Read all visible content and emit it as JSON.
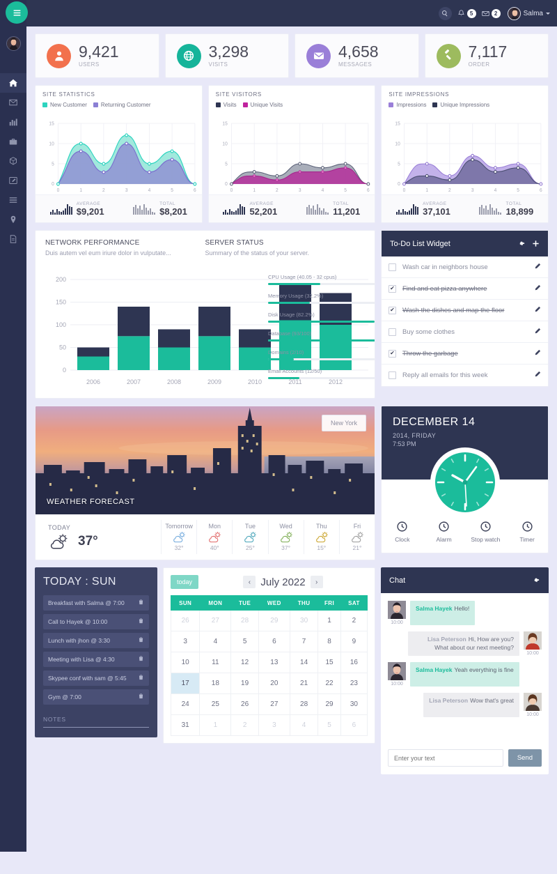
{
  "topbar": {
    "search_icon": "search-icon",
    "notifications_count": "5",
    "messages_count": "2",
    "user_name": "Salma"
  },
  "sidebar": {
    "toggle_icon": "hamburger-icon",
    "items": [
      {
        "icon": "home-icon",
        "active": true
      },
      {
        "icon": "envelope-icon",
        "active": false
      },
      {
        "icon": "bar-chart-icon",
        "active": false
      },
      {
        "icon": "briefcase-icon",
        "active": false
      },
      {
        "icon": "cube-icon",
        "active": false
      },
      {
        "icon": "edit-icon",
        "active": false
      },
      {
        "icon": "list-icon",
        "active": false
      },
      {
        "icon": "map-marker-icon",
        "active": false
      },
      {
        "icon": "file-icon",
        "active": false
      }
    ]
  },
  "stats": [
    {
      "value": "9,421",
      "label": "USERS",
      "color": "#f2714d",
      "icon": "user-icon"
    },
    {
      "value": "3,298",
      "label": "VISITS",
      "color": "#16b49a",
      "icon": "globe-icon"
    },
    {
      "value": "4,658",
      "label": "MESSAGES",
      "color": "#9a7fd8",
      "icon": "envelope-icon"
    },
    {
      "value": "7,117",
      "label": "ORDER",
      "color": "#9dbb5e",
      "icon": "gavel-icon"
    }
  ],
  "chart_data": [
    {
      "type": "area",
      "title": "SITE STATISTICS",
      "x": [
        0,
        1,
        2,
        3,
        4,
        5,
        6
      ],
      "series": [
        {
          "name": "New Customer",
          "color": "#2dd4bf",
          "values": [
            0,
            10,
            5,
            12,
            5,
            8,
            0
          ]
        },
        {
          "name": "Returning Customer",
          "color": "#8b7fd4",
          "values": [
            0,
            8,
            3,
            10,
            3,
            6,
            0
          ]
        }
      ],
      "ylim": [
        0,
        15
      ],
      "yticks": [
        0,
        5,
        10,
        15
      ],
      "xlabel": "",
      "ylabel": "",
      "grid": true,
      "legend": "top",
      "footer": {
        "average_label": "AVERAGE",
        "average_value": "$9,201",
        "total_label": "TOTAL",
        "total_value": "$8,201"
      }
    },
    {
      "type": "area",
      "title": "SITE VISITORS",
      "x": [
        0,
        1,
        2,
        3,
        4,
        5,
        6
      ],
      "series": [
        {
          "name": "Visits",
          "color": "#2e3552",
          "values": [
            0,
            3,
            2,
            5,
            4,
            5,
            0
          ]
        },
        {
          "name": "Unique Visits",
          "color": "#c0239e",
          "values": [
            0,
            2,
            1,
            3,
            3,
            4,
            0
          ]
        }
      ],
      "ylim": [
        0,
        15
      ],
      "yticks": [
        0,
        5,
        10,
        15
      ],
      "xlabel": "",
      "ylabel": "",
      "grid": true,
      "legend": "top",
      "footer": {
        "average_label": "AVERAGE",
        "average_value": "52,201",
        "total_label": "TOTAL",
        "total_value": "11,201"
      }
    },
    {
      "type": "area",
      "title": "SITE IMPRESSIONS",
      "x": [
        0,
        1,
        2,
        3,
        4,
        5,
        6
      ],
      "series": [
        {
          "name": "Impressions",
          "color": "#9a7fd8",
          "values": [
            0,
            5,
            2,
            7,
            4,
            5,
            0
          ]
        },
        {
          "name": "Unique Impressions",
          "color": "#2e3552",
          "values": [
            0,
            2,
            1,
            6,
            3,
            4,
            0
          ]
        }
      ],
      "ylim": [
        0,
        15
      ],
      "yticks": [
        0,
        5,
        10,
        15
      ],
      "xlabel": "",
      "ylabel": "",
      "grid": true,
      "legend": "top",
      "footer": {
        "average_label": "AVERAGE",
        "average_value": "37,101",
        "total_label": "TOTAL",
        "total_value": "18,899"
      }
    },
    {
      "type": "bar",
      "title": "NETWORK PERFORMANCE",
      "subtitle": "Duis autem vel eum iriure dolor in vulputate...",
      "categories": [
        "2006",
        "2007",
        "2008",
        "2009",
        "2010",
        "2011",
        "2012"
      ],
      "series": [
        {
          "name": "lower",
          "color": "#1bbc9b",
          "values": [
            30,
            75,
            50,
            75,
            50,
            110,
            100
          ]
        },
        {
          "name": "upper",
          "color": "#2e3552",
          "values": [
            20,
            65,
            40,
            65,
            40,
            80,
            70
          ]
        }
      ],
      "totals": [
        50,
        140,
        90,
        140,
        90,
        190,
        170
      ],
      "ylim": [
        0,
        220
      ],
      "yticks": [
        0,
        50,
        100,
        150,
        200
      ],
      "grid": true,
      "stacked": true
    }
  ],
  "server_status": {
    "title": "SERVER STATUS",
    "subtitle": "Summary of the status of your server.",
    "rows": [
      {
        "label": "CPU Usage (40.05 - 32 cpus)",
        "percent": 40
      },
      {
        "label": "Memory Usage (32.2%)",
        "percent": 32
      },
      {
        "label": "Disk Usage (82.2%)",
        "percent": 82
      },
      {
        "label": "Database (93/100)",
        "percent": 93
      },
      {
        "label": "Domains (2/10)",
        "percent": 20
      },
      {
        "label": "Email Accounts (12/50)",
        "percent": 24
      }
    ]
  },
  "todo": {
    "title": "To-Do List Widget",
    "gear_icon": "gear-icon",
    "add_icon": "plus-icon",
    "items": [
      {
        "text": "Wash car in neighbors house",
        "done": false
      },
      {
        "text": "Find and eat pizza anywhere",
        "done": true
      },
      {
        "text": "Wash the dishes and map the floor",
        "done": true
      },
      {
        "text": "Buy some clothes",
        "done": false
      },
      {
        "text": "Throw the garbage",
        "done": true
      },
      {
        "text": "Reply all emails for this week",
        "done": false
      }
    ]
  },
  "weather": {
    "hero_title": "WEATHER FORECAST",
    "city": "New York",
    "today_label": "TODAY",
    "today_temp": "37°",
    "days": [
      {
        "day": "Tomorrow",
        "temp": "32°",
        "color": "#6fa8dc"
      },
      {
        "day": "Mon",
        "temp": "40°",
        "color": "#e06666"
      },
      {
        "day": "Tue",
        "temp": "25°",
        "color": "#45a3b8"
      },
      {
        "day": "Wed",
        "temp": "37°",
        "color": "#7aab4f"
      },
      {
        "day": "Thu",
        "temp": "15°",
        "color": "#c9a227"
      },
      {
        "day": "Fri",
        "temp": "21°",
        "color": "#9a9a9a"
      }
    ]
  },
  "clock": {
    "date": "DECEMBER 14",
    "year_day": "2014, FRIDAY",
    "time": "7:53 PM",
    "actions": [
      {
        "label": "Clock",
        "icon": "clock-icon"
      },
      {
        "label": "Alarm",
        "icon": "alarm-icon"
      },
      {
        "label": "Stop watch",
        "icon": "stopwatch-icon"
      },
      {
        "label": "Timer",
        "icon": "timer-icon"
      }
    ]
  },
  "agenda": {
    "title": "TODAY : SUN",
    "items": [
      "Breakfast with Salma @ 7:00",
      "Call to Hayek @ 10:00",
      "Lunch with jhon @ 3:30",
      "Meeting with Lisa @ 4:30",
      "Skypee conf with sam @ 5:45",
      "Gym @ 7:00"
    ],
    "notes_label": "NOTES"
  },
  "calendar": {
    "today_button": "today",
    "month": "July 2022",
    "prev_icon": "chevron-left-icon",
    "next_icon": "chevron-right-icon",
    "weekdays": [
      "SUN",
      "MON",
      "TUE",
      "WED",
      "THU",
      "FRI",
      "SAT"
    ],
    "weeks": [
      [
        {
          "d": "26",
          "o": true
        },
        {
          "d": "27",
          "o": true
        },
        {
          "d": "28",
          "o": true
        },
        {
          "d": "29",
          "o": true
        },
        {
          "d": "30",
          "o": true
        },
        {
          "d": "1"
        },
        {
          "d": "2"
        }
      ],
      [
        {
          "d": "3"
        },
        {
          "d": "4"
        },
        {
          "d": "5"
        },
        {
          "d": "6"
        },
        {
          "d": "7"
        },
        {
          "d": "8"
        },
        {
          "d": "9"
        }
      ],
      [
        {
          "d": "10"
        },
        {
          "d": "11"
        },
        {
          "d": "12"
        },
        {
          "d": "13"
        },
        {
          "d": "14"
        },
        {
          "d": "15"
        },
        {
          "d": "16"
        }
      ],
      [
        {
          "d": "17",
          "sel": true
        },
        {
          "d": "18"
        },
        {
          "d": "19"
        },
        {
          "d": "20"
        },
        {
          "d": "21"
        },
        {
          "d": "22"
        },
        {
          "d": "23"
        }
      ],
      [
        {
          "d": "24"
        },
        {
          "d": "25"
        },
        {
          "d": "26"
        },
        {
          "d": "27"
        },
        {
          "d": "28"
        },
        {
          "d": "29"
        },
        {
          "d": "30"
        }
      ],
      [
        {
          "d": "31"
        },
        {
          "d": "1",
          "o": true
        },
        {
          "d": "2",
          "o": true
        },
        {
          "d": "3",
          "o": true
        },
        {
          "d": "4",
          "o": true
        },
        {
          "d": "5",
          "o": true
        },
        {
          "d": "6",
          "o": true
        }
      ]
    ]
  },
  "chat": {
    "title": "Chat",
    "gear_icon": "gear-icon",
    "messages": [
      {
        "dir": "in",
        "name": "Salma Hayek",
        "text": "Hello!",
        "time": "10:00"
      },
      {
        "dir": "out",
        "name": "Lisa Peterson",
        "text": "Hi, How are you? What about our next meeting?",
        "time": "10:00"
      },
      {
        "dir": "in",
        "name": "Salma Hayek",
        "text": "Yeah everything is fine",
        "time": "10:00"
      },
      {
        "dir": "out",
        "name": "Lisa Peterson",
        "text": "Wow that's great",
        "time": "10:00"
      }
    ],
    "input_placeholder": "Enter your text",
    "send_label": "Send"
  }
}
